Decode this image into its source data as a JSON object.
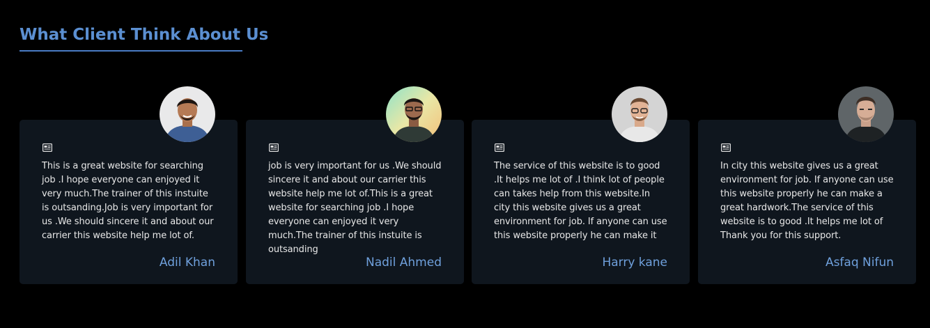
{
  "section": {
    "title": "What Client Think About Us"
  },
  "testimonials": [
    {
      "quote_icon": "newspaper-icon",
      "text": "This is a great website for searching job .I hope everyone can enjoyed it very much.The trainer of this instuite is outsanding.Job is very important for us .We should sincere it and about our carrier this website help me lot of.",
      "name": "Adil Khan"
    },
    {
      "quote_icon": "newspaper-icon",
      "text": "job is very important for us .We should sincere it and about our carrier this website help me lot of.This is a great website for searching job .I hope everyone can enjoyed it very much.The trainer of this instuite is outsanding",
      "name": "Nadil Ahmed"
    },
    {
      "quote_icon": "newspaper-icon",
      "text": "The service of this website is to good .It helps me lot of .I think lot of people can takes help from this website.In city this website gives us a great environment for job. If anyone can use this website properly he can make it",
      "name": "Harry kane"
    },
    {
      "quote_icon": "newspaper-icon",
      "text": "In city this website gives us a great environment for job. If anyone can use this website properly he can make a great hardwork.The service of this website is to good .It helps me lot of Thank you for this support.",
      "name": "Asfaq Nifun"
    }
  ],
  "colors": {
    "background": "#000000",
    "card": "#0f161e",
    "accent": "#5b8fd1",
    "name": "#6fa0dc"
  }
}
